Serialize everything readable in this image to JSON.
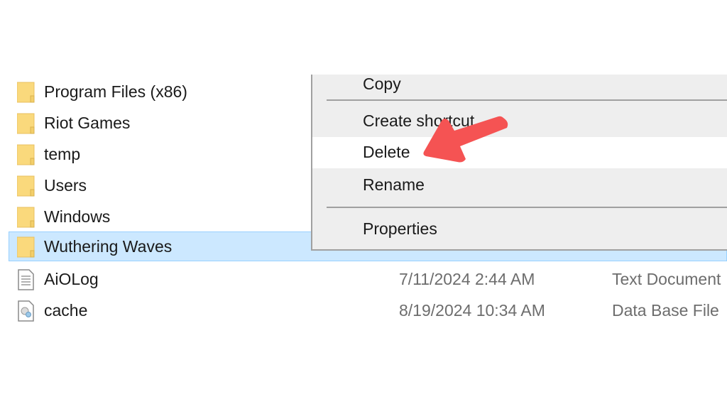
{
  "files": [
    {
      "name": "Program Files (x86)",
      "icon": "folder-icon",
      "date": "",
      "type": "",
      "selected": false
    },
    {
      "name": "Riot Games",
      "icon": "folder-icon",
      "date": "",
      "type": "",
      "selected": false
    },
    {
      "name": "temp",
      "icon": "folder-icon",
      "date": "",
      "type": "",
      "selected": false
    },
    {
      "name": "Users",
      "icon": "folder-icon",
      "date": "",
      "type": "",
      "selected": false
    },
    {
      "name": "Windows",
      "icon": "folder-icon",
      "date": "",
      "type": "",
      "selected": false
    },
    {
      "name": "Wuthering Waves",
      "icon": "folder-icon",
      "date": "",
      "type": "",
      "selected": true
    },
    {
      "name": "AiOLog",
      "icon": "text-file-icon",
      "date": "7/11/2024 2:44 AM",
      "type": "Text Document",
      "selected": false
    },
    {
      "name": "cache",
      "icon": "database-file-icon",
      "date": "8/19/2024 10:34 AM",
      "type": "Data Base File",
      "selected": false
    }
  ],
  "context_menu": {
    "items": [
      {
        "label": "Copy"
      },
      {
        "label": "Create shortcut"
      },
      {
        "label": "Delete",
        "highlighted": true
      },
      {
        "label": "Rename"
      },
      {
        "label": "Properties"
      }
    ]
  },
  "annotation": {
    "arrow_color": "#f55353",
    "points_to": "Delete"
  }
}
